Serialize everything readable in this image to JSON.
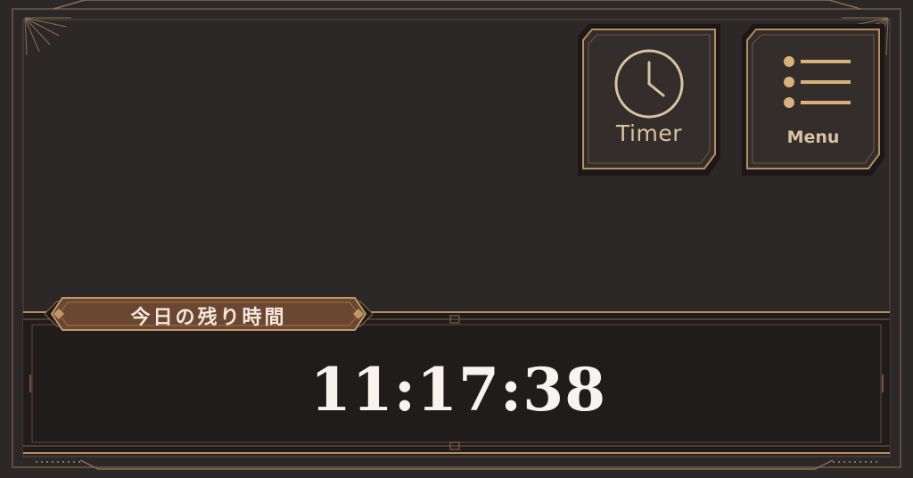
{
  "buttons": {
    "timer_label": "Timer",
    "menu_label": "Menu"
  },
  "panel": {
    "title": "今日の残り時間",
    "time_remaining": "11:17:38"
  },
  "colors": {
    "background": "#2c2828",
    "gold": "#b88d5c",
    "panel_dark": "#211c1c",
    "ribbon_brown": "#6b4630",
    "button_fill": "#332d2b",
    "text_light": "#f7f3ee"
  },
  "icons": {
    "timer": "clock-icon",
    "menu": "list-menu-icon"
  }
}
